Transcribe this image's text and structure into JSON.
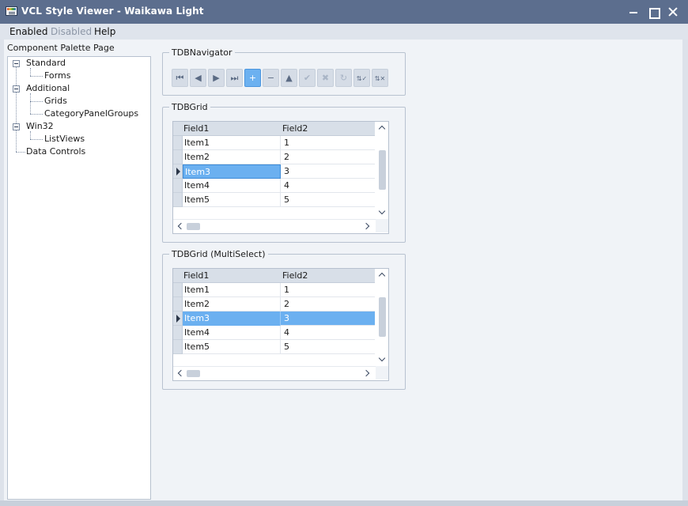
{
  "window": {
    "title": "VCL Style Viewer - Waikawa Light"
  },
  "menu": {
    "items": [
      {
        "label": "Enabled",
        "disabled": false
      },
      {
        "label": "Disabled",
        "disabled": true
      },
      {
        "label": "Help",
        "disabled": false
      }
    ]
  },
  "palette": {
    "label": "Component Palette Page",
    "tree": [
      {
        "label": "Standard",
        "children": [
          "Forms"
        ]
      },
      {
        "label": "Additional",
        "children": [
          "Grids",
          "CategoryPanelGroups"
        ]
      },
      {
        "label": "Win32",
        "children": [
          "ListViews"
        ]
      },
      {
        "label": "Data Controls",
        "children": []
      }
    ]
  },
  "navigator": {
    "caption": "TDBNavigator",
    "buttons": [
      {
        "icon": "first-record-icon",
        "glyph": "⏮"
      },
      {
        "icon": "prior-record-icon",
        "glyph": "◀"
      },
      {
        "icon": "next-record-icon",
        "glyph": "▶"
      },
      {
        "icon": "last-record-icon",
        "glyph": "⏭"
      },
      {
        "icon": "insert-record-icon",
        "glyph": "+",
        "active": true
      },
      {
        "icon": "delete-record-icon",
        "glyph": "−"
      },
      {
        "icon": "edit-record-icon",
        "glyph": "▲"
      },
      {
        "icon": "post-edit-icon",
        "glyph": "✔",
        "dim": true
      },
      {
        "icon": "cancel-edit-icon",
        "glyph": "✖",
        "dim": true
      },
      {
        "icon": "refresh-data-icon",
        "glyph": "↻",
        "dim": true
      },
      {
        "icon": "apply-updates-icon",
        "glyph": "⇅✓"
      },
      {
        "icon": "cancel-updates-icon",
        "glyph": "⇅✕"
      }
    ]
  },
  "grid": {
    "caption": "TDBGrid",
    "columns": [
      "Field1",
      "Field2"
    ],
    "rows": [
      [
        "Item1",
        "1"
      ],
      [
        "Item2",
        "2"
      ],
      [
        "Item3",
        "3"
      ],
      [
        "Item4",
        "4"
      ],
      [
        "Item5",
        "5"
      ]
    ],
    "current_row": 2
  },
  "grid_multi": {
    "caption": "TDBGrid (MultiSelect)",
    "columns": [
      "Field1",
      "Field2"
    ],
    "rows": [
      [
        "Item1",
        "1"
      ],
      [
        "Item2",
        "2"
      ],
      [
        "Item3",
        "3"
      ],
      [
        "Item4",
        "4"
      ],
      [
        "Item5",
        "5"
      ]
    ],
    "current_row": 2
  },
  "colors": {
    "accent": "#6bb0f0",
    "titlebar": "#5c6e8e"
  }
}
